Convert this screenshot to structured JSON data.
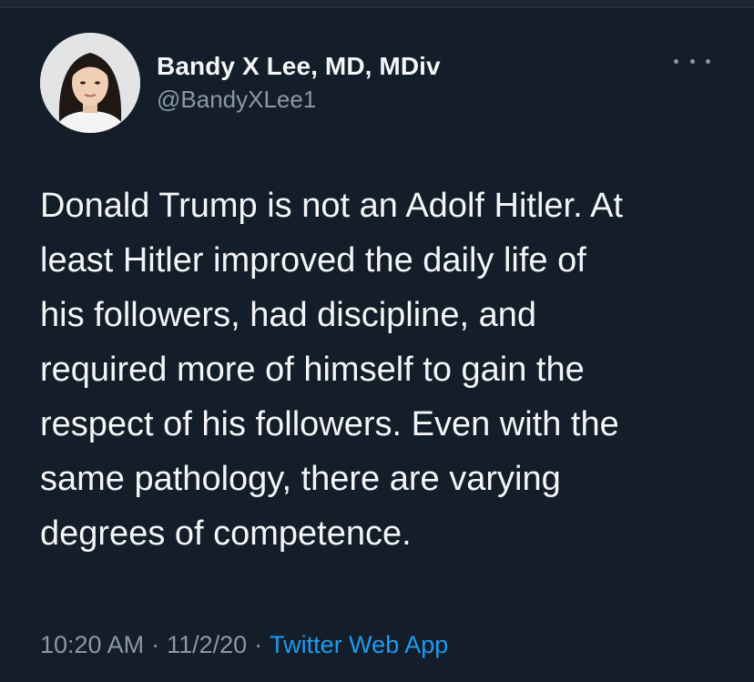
{
  "author": {
    "display_name": "Bandy X Lee, MD, MDiv",
    "handle": "@BandyXLee1",
    "avatar_icon": "profile-photo"
  },
  "tweet": {
    "text": "Donald Trump is not an Adolf Hitler.  At\nleast Hitler improved the daily life of\nhis followers, had discipline, and\nrequired more of himself to gain the\nrespect of his followers.  Even with the\nsame pathology, there are varying\ndegrees of competence."
  },
  "meta": {
    "time": "10:20 AM",
    "separator": "·",
    "date": "11/2/20",
    "source": "Twitter Web App"
  },
  "menu": {
    "icon": "more-icon"
  },
  "colors": {
    "background": "#141d2a",
    "text": "#f3f5f7",
    "secondary": "#8b98a5",
    "link": "#1d9bf0"
  }
}
